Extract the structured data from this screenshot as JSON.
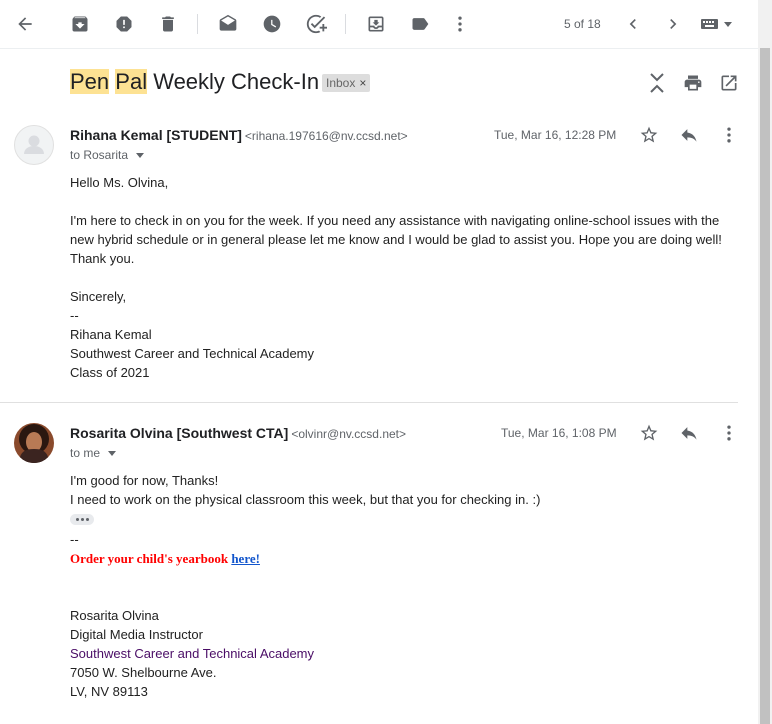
{
  "toolbar": {
    "buttons": [
      {
        "name": "back-icon"
      },
      {
        "name": "archive-icon"
      },
      {
        "name": "report-spam-icon"
      },
      {
        "name": "delete-icon"
      },
      {
        "name": "mark-unread-icon"
      },
      {
        "name": "snooze-icon"
      },
      {
        "name": "add-task-icon"
      },
      {
        "name": "move-to-icon"
      },
      {
        "name": "label-icon"
      },
      {
        "name": "more-icon"
      }
    ],
    "pager": "5 of 18"
  },
  "subject": {
    "part1": "Pen",
    "part2": "Pal",
    "rest": "Weekly Check-In",
    "label_chip": "Inbox",
    "chip_close": "×"
  },
  "messages": [
    {
      "sender_name": "Rihana Kemal [STUDENT]",
      "sender_email": "<rihana.197616@nv.ccsd.net>",
      "to": "to Rosarita",
      "date": "Tue, Mar 16, 12:28 PM",
      "lines": [
        "Hello Ms. Olvina,",
        "I'm here to check in on you for the week. If you need any assistance with navigating online-school issues with the",
        "new hybrid schedule or in general please let me know and I would be glad to assist you. Hope you are doing well!",
        "Thank you.",
        "Sincerely,",
        "--",
        "Rihana Kemal",
        "Southwest Career and Technical Academy",
        "Class of 2021"
      ]
    },
    {
      "sender_name": "Rosarita Olvina [Southwest CTA]",
      "sender_email": "<olvinr@nv.ccsd.net>",
      "to": "to me",
      "date": "Tue, Mar 16, 1:08 PM",
      "lines": [
        "I'm good for now, Thanks!",
        "I need to work on the physical classroom this week, but that you for checking in. :)",
        "--"
      ],
      "yearbook_text": "Order your child's yearbook ",
      "yearbook_link": "here!",
      "signature": [
        "Rosarita Olvina",
        "Digital Media Instructor",
        "Southwest Career and Technical Academy",
        "7050 W. Shelbourne Ave.",
        "LV, NV  89113"
      ]
    }
  ],
  "colors": {
    "highlight": "#fde293",
    "yearbook_red": "#ff0000",
    "link_blue": "#1155cc",
    "signature_purple": "#4a0d66"
  }
}
